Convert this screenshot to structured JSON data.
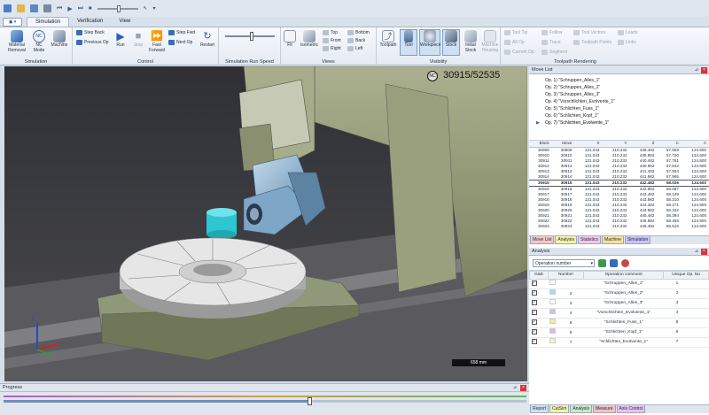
{
  "ribbon_tabs": [
    {
      "label": "Simulation",
      "active": true
    },
    {
      "label": "Verification",
      "active": false
    },
    {
      "label": "View",
      "active": false
    }
  ],
  "ribbon": {
    "simulation_group": {
      "label": "Simulation",
      "material_removal": "Material Removal",
      "nc_mode": "NC Mode",
      "machine": "Machine"
    },
    "control_group": {
      "label": "Control",
      "step_back": "Step Back",
      "previous_op": "Previous Op",
      "run": "Run",
      "stop": "Stop",
      "fast_forward": "Fast Forward",
      "step_fwd": "Step Fwd",
      "next_op": "Next Op",
      "restart": "Restart"
    },
    "speed_group": {
      "label": "Simulation Run Speed"
    },
    "views_group": {
      "label": "Views",
      "fit": "Fit",
      "isometric": "Isometric",
      "top": "Top",
      "front": "Front",
      "right": "Right",
      "bottom": "Bottom",
      "back": "Back",
      "left": "Left"
    },
    "visibility_group": {
      "label": "Visibility",
      "toolpath": "Toolpath",
      "tool": "Tool",
      "workpiece": "Workpiece",
      "stock": "Stock",
      "initial_stock": "Initial Stock",
      "machine_housing": "Machine Housing"
    },
    "toolpath_group": {
      "label": "Toolpath Rendering",
      "tool_tip": "Tool Tip",
      "follow": "Follow",
      "tool_vectors": "Tool Vectors",
      "leads": "Leads",
      "all_op": "All Op",
      "trace": "Trace",
      "toolpath_points": "Toolpath Points",
      "links": "Links",
      "current_op": "Current Op",
      "segment": "Segment"
    }
  },
  "viewport": {
    "nc_badge": "NC",
    "block_counter": "30915/52535",
    "scale_label": "658 mm",
    "axis_z": "Z",
    "axis_y": "Y",
    "axis_x": "X"
  },
  "move_list": {
    "title": "Move List",
    "ops": [
      "Op. 1) \"Schruppen_Alles_1\"",
      "Op. 2) \"Schruppen_Alles_2\"",
      "Op. 3) \"Schruppen_Alles_3\"",
      "Op. 4) \"Vorschlichten_Evolvente_1\"",
      "Op. 5) \"Schlichten_Fuss_1\"",
      "Op. 6) \"Schlichten_Kopf_1\"",
      "Op. 7) \"Schlichten_Evolvente_1\""
    ],
    "columns": [
      "Block",
      "Move",
      "X",
      "Y",
      "Z",
      "C",
      "A"
    ],
    "rows": [
      [
        "30909",
        "30909",
        "131.043",
        "210.232",
        "439.482",
        "57.659",
        "124.600"
      ],
      [
        "30910",
        "30910",
        "131.043",
        "210.232",
        "439.982",
        "57.720",
        "124.600"
      ],
      [
        "30911",
        "30911",
        "131.043",
        "210.232",
        "440.482",
        "57.781",
        "124.600"
      ],
      [
        "30912",
        "30912",
        "131.043",
        "210.232",
        "440.982",
        "57.842",
        "124.600"
      ],
      [
        "30913",
        "30913",
        "131.043",
        "210.232",
        "441.482",
        "57.904",
        "124.600"
      ],
      [
        "30914",
        "30914",
        "131.043",
        "210.232",
        "441.982",
        "57.965",
        "124.600"
      ],
      [
        "30915",
        "30915",
        "131.043",
        "210.232",
        "442.482",
        "58.026",
        "124.600"
      ],
      [
        "30916",
        "30916",
        "131.043",
        "210.232",
        "442.982",
        "58.087",
        "124.600"
      ],
      [
        "30917",
        "30917",
        "131.043",
        "210.232",
        "443.482",
        "58.149",
        "124.600"
      ],
      [
        "30918",
        "30918",
        "131.043",
        "210.232",
        "443.982",
        "58.210",
        "124.600"
      ],
      [
        "30919",
        "30919",
        "131.043",
        "210.232",
        "444.482",
        "58.271",
        "124.600"
      ],
      [
        "30920",
        "30920",
        "131.043",
        "210.232",
        "444.982",
        "58.332",
        "124.600"
      ],
      [
        "30921",
        "30921",
        "131.043",
        "210.232",
        "445.482",
        "58.394",
        "124.600"
      ],
      [
        "30922",
        "30922",
        "131.043",
        "210.232",
        "445.982",
        "58.455",
        "124.600"
      ],
      [
        "30923",
        "30923",
        "131.043",
        "210.232",
        "446.482",
        "58.516",
        "124.600"
      ]
    ],
    "tabs": [
      {
        "label": "Move List",
        "color": "#f6c6c6"
      },
      {
        "label": "Analysis",
        "color": "#f4f0a8"
      },
      {
        "label": "Statistics",
        "color": "#f3c7ea"
      },
      {
        "label": "Machine",
        "color": "#f9e09a"
      },
      {
        "label": "Simulation",
        "color": "#c9c3f3"
      }
    ]
  },
  "analysis": {
    "title": "Analysis",
    "filter": "Operation number",
    "columns": [
      "G&E",
      "Number",
      "Operation comment",
      "Unique Op. No"
    ],
    "rows": [
      {
        "color": "#ffffff",
        "number": "",
        "comment": "\"Schruppen_Alles_1\"",
        "unique": "1"
      },
      {
        "color": "#a8dde8",
        "number": "2",
        "comment": "\"Schruppen_Alles_2\"",
        "unique": "2"
      },
      {
        "color": "#ffffff",
        "number": "3",
        "comment": "\"Schruppen_Alles_3\"",
        "unique": "3"
      },
      {
        "color": "#c9c2ea",
        "number": "4",
        "comment": "\"Vorschlichten_Evolvente_1\"",
        "unique": "4"
      },
      {
        "color": "#f2eda3",
        "number": "5",
        "comment": "\"Schlichten_Fuss_1\"",
        "unique": "5"
      },
      {
        "color": "#e6b5e6",
        "number": "6",
        "comment": "\"Schlichten_Kopf_1\"",
        "unique": "6"
      },
      {
        "color": "#f5f5bb",
        "number": "7",
        "comment": "\"Schlichten_Evolvente_1\"",
        "unique": "7"
      }
    ],
    "tabs": [
      {
        "label": "Report",
        "color": "#cfe0f3"
      },
      {
        "label": "CutSim",
        "color": "#f4f0a8"
      },
      {
        "label": "Analysis",
        "color": "#c8e8c3"
      },
      {
        "label": "Measure",
        "color": "#f3c1c1"
      },
      {
        "label": "Axis Control",
        "color": "#e7c2f0"
      }
    ]
  },
  "progress": {
    "title": "Progress",
    "fraction": 0.585
  }
}
